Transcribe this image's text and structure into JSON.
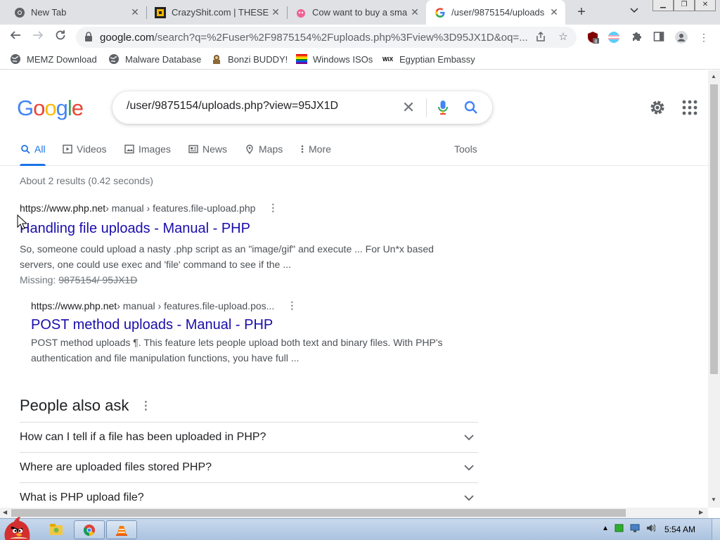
{
  "browser": {
    "tabs": [
      {
        "title": "New Tab",
        "icon": "chrome-icon",
        "active": false
      },
      {
        "title": "CrazyShit.com | THESE",
        "icon": "crazyshit-icon",
        "active": false
      },
      {
        "title": "Cow want to buy a sma",
        "icon": "pink-cow-icon",
        "active": false
      },
      {
        "title": "/user/9875154/uploads",
        "icon": "google-icon",
        "active": true
      }
    ],
    "new_tab_label": "+",
    "url_host": "google.com",
    "url_rest": "/search?q=%2Fuser%2F9875154%2Fuploads.php%3Fview%3D95JX1D&oq=...",
    "extension_badge": "8",
    "bookmarks": [
      {
        "label": "MEMZ Download",
        "icon": "globe-icon"
      },
      {
        "label": "Malware Database",
        "icon": "globe-icon"
      },
      {
        "label": "Bonzi BUDDY!",
        "icon": "bonzi-icon"
      },
      {
        "label": "Windows ISOs",
        "icon": "rainbow-flag-icon"
      },
      {
        "label": "Egyptian Embassy",
        "icon": "wix-icon"
      }
    ]
  },
  "google": {
    "logo_letters": [
      "G",
      "o",
      "o",
      "g",
      "l",
      "e"
    ],
    "logo_colors": [
      "#4285f4",
      "#ea4335",
      "#fbbc05",
      "#4285f4",
      "#34a853",
      "#ea4335"
    ],
    "query": "/user/9875154/uploads.php?view=95JX1D",
    "tabs": [
      "All",
      "Videos",
      "Images",
      "News",
      "Maps",
      "More"
    ],
    "tools_label": "Tools",
    "stats": "About 2 results (0.42 seconds)",
    "results": [
      {
        "site": "https://www.php.net",
        "path": " › manual › features.file-upload.php",
        "title": "Handling file uploads - Manual - PHP",
        "snippet": "So, someone could upload a nasty .php script as an \"image/gif\" and execute ... For Un*x based servers, one could use exec and 'file' command to see if the ...",
        "missing_label": "Missing: ",
        "missing_terms": "9875154/ 95JX1D"
      },
      {
        "site": "https://www.php.net",
        "path": " › manual › features.file-upload.pos...",
        "title": "POST method uploads - Manual - PHP",
        "snippet": "POST method uploads ¶. This feature lets people upload both text and binary files. With PHP's authentication and file manipulation functions, you have full ..."
      }
    ],
    "people_also_ask": {
      "heading": "People also ask",
      "questions": [
        "How can I tell if a file has been uploaded in PHP?",
        "Where are uploaded files stored PHP?",
        "What is PHP upload file?"
      ]
    }
  },
  "taskbar": {
    "clock": "5:54 AM"
  },
  "colors": {
    "link": "#1a0dab",
    "accent": "#1a73e8",
    "tab_strip": "#dfe1e5"
  }
}
